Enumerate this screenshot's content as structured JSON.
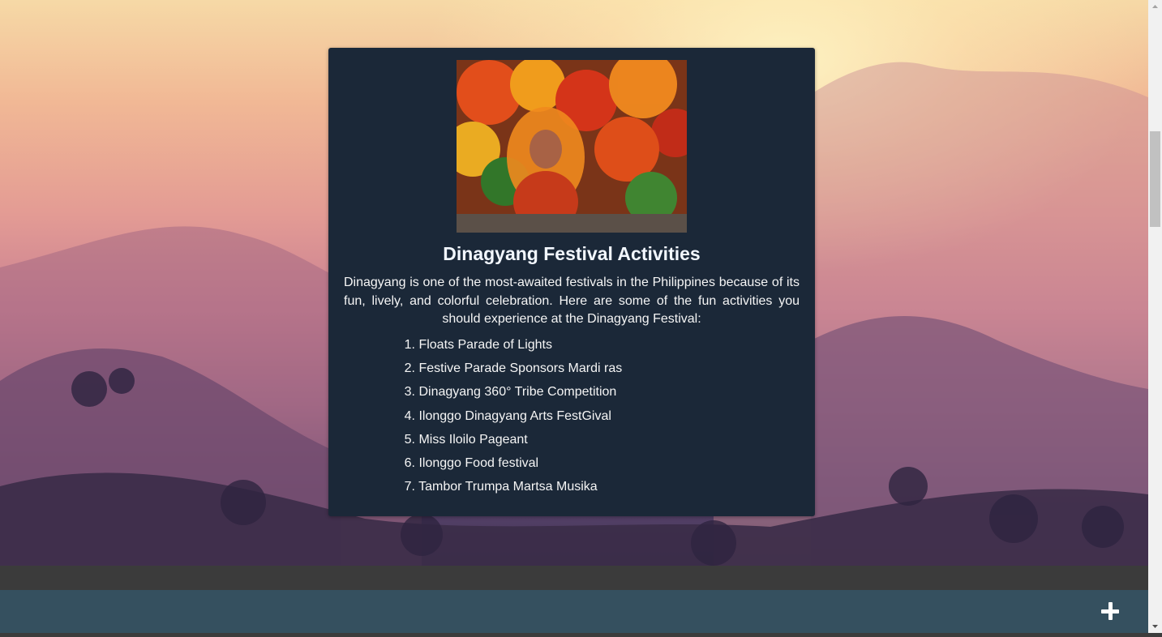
{
  "card": {
    "image_alt": "Dinagyang festival dancers in colorful feathered costumes",
    "title": "Dinagyang Festival Activities",
    "description": "Dinagyang is one of the most-awaited festivals in the Philippines because of its fun, lively, and colorful celebration. Here are some of the fun activities you should experience at the Dinagyang Festival:",
    "activities": [
      {
        "num": "1.",
        "label": "Floats Parade of Lights"
      },
      {
        "num": "2.",
        "label": "Festive Parade Sponsors Mardi ras"
      },
      {
        "num": "3.",
        "label": "Dinagyang 360° Tribe Competition"
      },
      {
        "num": "4.",
        "label": "Ilonggo Dinagyang Arts FestGival"
      },
      {
        "num": "5.",
        "label": "Miss Iloilo Pageant"
      },
      {
        "num": "6.",
        "label": "Ilonggo Food festival"
      },
      {
        "num": "7.",
        "label": "Tambor Trumpa Martsa Musika"
      }
    ]
  },
  "footer": {
    "plus_icon": "plus-icon"
  },
  "colors": {
    "card_bg": "#1b2838",
    "footer_bar": "#35505f",
    "footer_gap": "#3b3b3b"
  }
}
